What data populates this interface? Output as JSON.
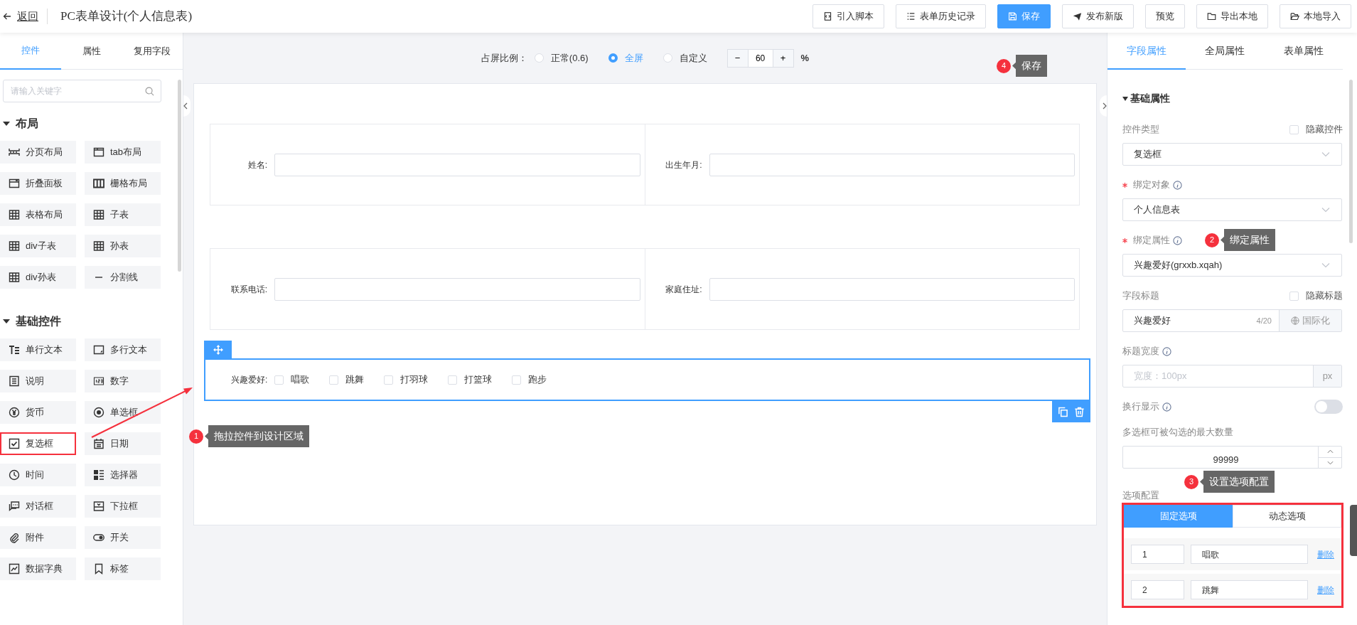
{
  "header": {
    "back": "返回",
    "title": "PC表单设计(个人信息表)",
    "buttons": [
      {
        "label": "引入脚本",
        "kind": "script",
        "primary": false
      },
      {
        "label": "表单历史记录",
        "kind": "list",
        "primary": false
      },
      {
        "label": "保存",
        "kind": "save",
        "primary": true
      },
      {
        "label": "发布新版",
        "kind": "send",
        "primary": false
      },
      {
        "label": "预览",
        "kind": "plain",
        "primary": false
      },
      {
        "label": "导出本地",
        "kind": "folder",
        "primary": false
      },
      {
        "label": "本地导入",
        "kind": "folder-open",
        "primary": false
      }
    ]
  },
  "left_panel": {
    "tabs": [
      {
        "label": "控件",
        "selected": true
      },
      {
        "label": "属性",
        "selected": false
      },
      {
        "label": "复用字段",
        "selected": false
      }
    ],
    "search": {
      "placeholder": "请输入关键字"
    },
    "groups": [
      {
        "title": "布局",
        "expanded": true,
        "items": [
          {
            "label": "分页布局",
            "kind": "paging",
            "highlighted": false
          },
          {
            "label": "tab布局",
            "kind": "tab",
            "highlighted": false
          },
          {
            "label": "折叠面板",
            "kind": "panel",
            "highlighted": false
          },
          {
            "label": "栅格布局",
            "kind": "columns",
            "highlighted": false
          },
          {
            "label": "表格布局",
            "kind": "table",
            "highlighted": false
          },
          {
            "label": "子表",
            "kind": "table",
            "highlighted": false
          },
          {
            "label": "div子表",
            "kind": "table",
            "highlighted": false
          },
          {
            "label": "孙表",
            "kind": "table",
            "highlighted": false
          },
          {
            "label": "div孙表",
            "kind": "table",
            "highlighted": false
          },
          {
            "label": "分割线",
            "kind": "divider",
            "highlighted": false
          }
        ]
      },
      {
        "title": "基础控件",
        "expanded": true,
        "items": [
          {
            "label": "单行文本",
            "kind": "text",
            "highlighted": false
          },
          {
            "label": "多行文本",
            "kind": "textarea",
            "highlighted": false
          },
          {
            "label": "说明",
            "kind": "doc",
            "highlighted": false
          },
          {
            "label": "数字",
            "kind": "number",
            "highlighted": false
          },
          {
            "label": "货币",
            "kind": "currency",
            "highlighted": false
          },
          {
            "label": "单选框",
            "kind": "radio",
            "highlighted": false
          },
          {
            "label": "复选框",
            "kind": "checkbox",
            "highlighted": true
          },
          {
            "label": "日期",
            "kind": "date",
            "highlighted": false
          },
          {
            "label": "时间",
            "kind": "clock",
            "highlighted": false
          },
          {
            "label": "选择器",
            "kind": "selector",
            "highlighted": false
          },
          {
            "label": "对话框",
            "kind": "chat",
            "highlighted": false
          },
          {
            "label": "下拉框",
            "kind": "dropdown",
            "highlighted": false
          },
          {
            "label": "附件",
            "kind": "clip",
            "highlighted": false
          },
          {
            "label": "开关",
            "kind": "switch",
            "highlighted": false
          },
          {
            "label": "数据字典",
            "kind": "dict",
            "highlighted": false
          },
          {
            "label": "标签",
            "kind": "tag",
            "highlighted": false
          }
        ]
      }
    ]
  },
  "canvas": {
    "ratio": {
      "label": "占屏比例：",
      "options": [
        {
          "label": "正常(0.6)",
          "selected": false
        },
        {
          "label": "全屏",
          "selected": true
        },
        {
          "label": "自定义",
          "selected": false
        }
      ],
      "stepper": {
        "minus": "−",
        "value": "60",
        "plus": "+",
        "unit": "%"
      }
    },
    "rows": [
      {
        "fields": [
          {
            "label": "姓名:"
          },
          {
            "label": "出生年月:"
          }
        ]
      },
      {
        "fields": [
          {
            "label": "联系电话:"
          },
          {
            "label": "家庭住址:"
          }
        ]
      }
    ],
    "selected_field": {
      "label": "兴趣爱好:",
      "options": [
        {
          "label": "唱歌",
          "checked": false
        },
        {
          "label": "跳舞",
          "checked": false
        },
        {
          "label": "打羽球",
          "checked": false
        },
        {
          "label": "打篮球",
          "checked": false
        },
        {
          "label": "跑步",
          "checked": false
        }
      ]
    }
  },
  "right_panel": {
    "tabs": [
      {
        "label": "字段属性",
        "selected": true
      },
      {
        "label": "全局属性",
        "selected": false
      },
      {
        "label": "表单属性",
        "selected": false
      }
    ],
    "section": {
      "title": "基础属性",
      "expanded": true
    },
    "fields": [
      {
        "kind": "select",
        "label": "控件类型",
        "required": false,
        "info": false,
        "extra": {
          "label": "隐藏控件",
          "checked": false
        },
        "value": "复选框"
      },
      {
        "kind": "select",
        "label": "绑定对象",
        "required": true,
        "info": true,
        "value": "个人信息表"
      },
      {
        "kind": "select",
        "label": "绑定属性",
        "required": true,
        "info": true,
        "value": "兴趣爱好(grxxb.xqah)"
      },
      {
        "kind": "counted",
        "label": "字段标题",
        "required": false,
        "info": false,
        "extra": {
          "label": "隐藏标题",
          "checked": false
        },
        "value": "兴趣爱好",
        "count": "4/20",
        "addon": "国际化"
      },
      {
        "kind": "addon",
        "label": "标题宽度",
        "required": false,
        "info": true,
        "placeholder": "宽度：100px",
        "addon": "px"
      },
      {
        "kind": "switch",
        "label": "换行显示",
        "required": false,
        "info": true,
        "on": false
      },
      {
        "kind": "number",
        "label": "多选框可被勾选的最大数量",
        "required": false,
        "info": false,
        "value": "99999"
      }
    ],
    "options": {
      "label": "选项配置",
      "highlighted": true,
      "tabs": [
        {
          "label": "固定选项",
          "selected": true
        },
        {
          "label": "动态选项",
          "selected": false
        }
      ],
      "rows": [
        {
          "value": "1",
          "label": "唱歌",
          "delete": "删除"
        },
        {
          "value": "2",
          "label": "跳舞",
          "delete": "删除"
        }
      ]
    }
  },
  "annotations": [
    {
      "kind": "design-area",
      "number": "1",
      "text": "拖拉控件到设计区域"
    },
    {
      "kind": "bind-field",
      "number": "2",
      "text": "绑定属性"
    },
    {
      "kind": "options",
      "number": "3",
      "text": "设置选项配置"
    },
    {
      "kind": "save",
      "number": "4",
      "text": "保存"
    }
  ]
}
